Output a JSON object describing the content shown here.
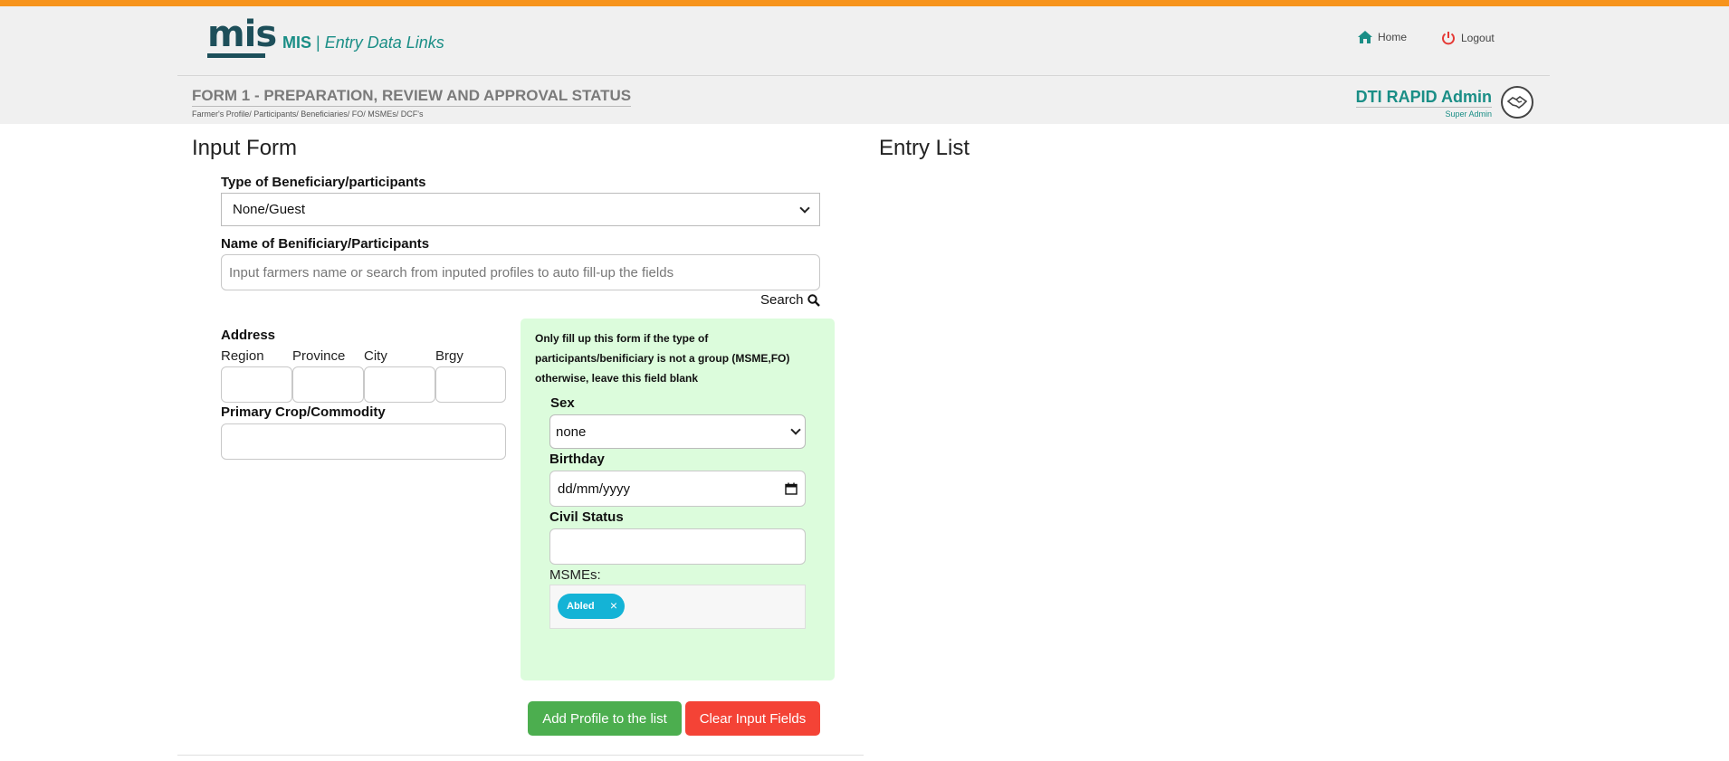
{
  "header": {
    "logo_text": "mis",
    "app_name": "MIS",
    "separator": "|",
    "section": "Entry Data Links",
    "nav": {
      "home": "Home",
      "logout": "Logout"
    },
    "form_title": "FORM 1 - PREPARATION, REVIEW AND APPROVAL STATUS",
    "form_subtitle": "Farmer's Profile/ Participants/ Beneficiaries/ FO/ MSMEs/ DCF's",
    "user_name": "DTI RAPID Admin",
    "user_role": "Super Admin"
  },
  "input_form": {
    "heading": "Input Form",
    "type_label": "Type of Beneficiary/participants",
    "type_value": "None/Guest",
    "name_label": "Name of Benificiary/Participants",
    "name_placeholder": "Input farmers name or search from inputed profiles to auto fill-up the fields",
    "search_label": "Search",
    "address_label": "Address",
    "region_label": "Region",
    "province_label": "Province",
    "city_label": "City",
    "brgy_label": "Brgy",
    "crop_label": "Primary Crop/Commodity",
    "panel_note": "Only fill up this form if the type of participants/benificiary is not a group (MSME,FO) otherwise, leave this field blank",
    "sex_label": "Sex",
    "sex_value": "none",
    "birthday_label": "Birthday",
    "birthday_placeholder": "dd/mm/yyyy",
    "civil_label": "Civil Status",
    "msme_label": "MSMEs:",
    "msme_tags": [
      "Abled"
    ],
    "add_button": "Add Profile to the list",
    "clear_button": "Clear Input Fields"
  },
  "entry_list": {
    "heading": "Entry List"
  },
  "colors": {
    "accent_bar": "#f7941d",
    "brand_teal": "#1a8e86",
    "panel_green": "#dcfcdc",
    "add_green": "#4cae4f",
    "clear_red": "#f44336",
    "tag_blue": "#14b3d6"
  }
}
